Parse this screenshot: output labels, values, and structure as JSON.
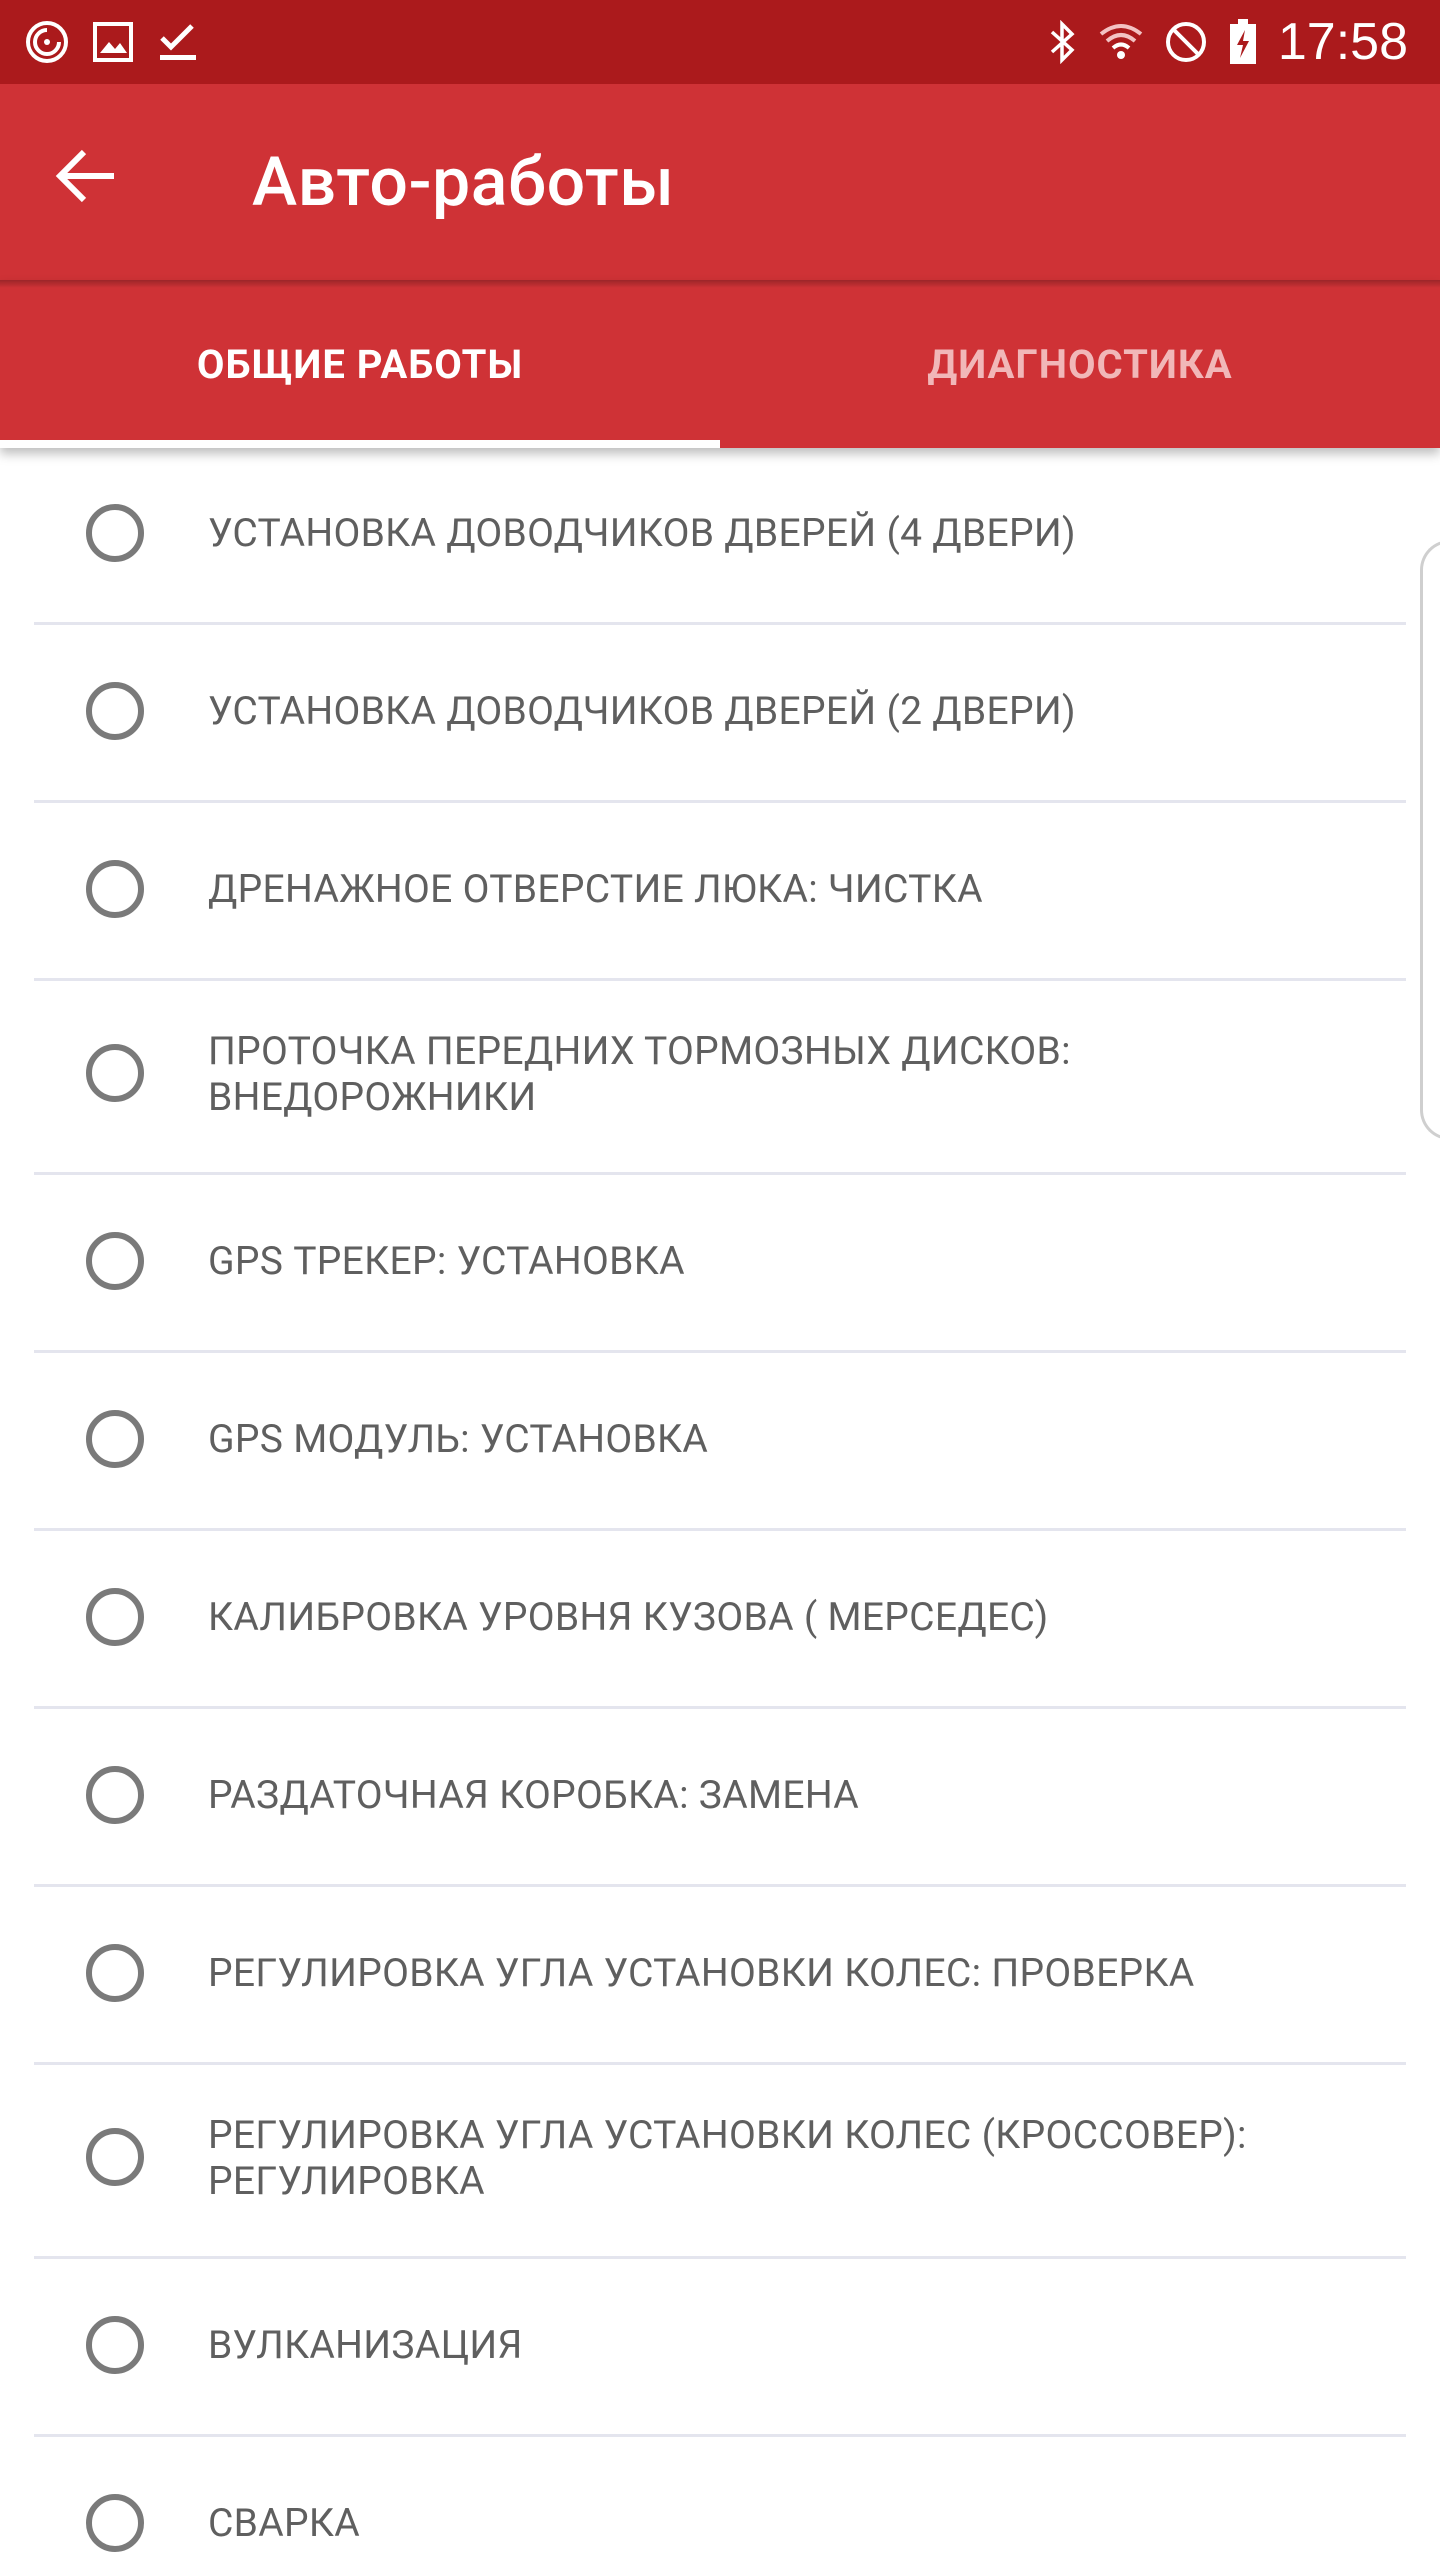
{
  "status_bar": {
    "time": "17:58",
    "left_icons": [
      "sync-icon",
      "image-icon",
      "check-icon"
    ],
    "right_icons": [
      "bluetooth-icon",
      "wifi-icon",
      "do-not-disturb-icon",
      "battery-charging-icon"
    ]
  },
  "app_bar": {
    "title": "Авто-работы"
  },
  "tabs": [
    {
      "label": "ОБЩИЕ РАБОТЫ",
      "active": true
    },
    {
      "label": "ДИАГНОСТИКА",
      "active": false
    }
  ],
  "items": [
    {
      "label": "УСТАНОВКА ДОВОДЧИКОВ ДВЕРЕЙ (4 ДВЕРИ)"
    },
    {
      "label": "УСТАНОВКА ДОВОДЧИКОВ ДВЕРЕЙ (2 ДВЕРИ)"
    },
    {
      "label": "ДРЕНАЖНОЕ ОТВЕРСТИЕ ЛЮКА: ЧИСТКА"
    },
    {
      "label": "ПРОТОЧКА ПЕРЕДНИХ ТОРМОЗНЫХ ДИСКОВ: ВНЕДОРОЖНИКИ"
    },
    {
      "label": "GPS ТРЕКЕР: УСТАНОВКА"
    },
    {
      "label": "GPS МОДУЛЬ: УСТАНОВКА"
    },
    {
      "label": "КАЛИБРОВКА УРОВНЯ КУЗОВА ( МЕРСЕДЕС)"
    },
    {
      "label": "РАЗДАТОЧНАЯ КОРОБКА: ЗАМЕНА"
    },
    {
      "label": "РЕГУЛИРОВКА УГЛА УСТАНОВКИ КОЛЕС: ПРОВЕРКА"
    },
    {
      "label": "РЕГУЛИРОВКА УГЛА УСТАНОВКИ КОЛЕС (КРОССОВЕР): РЕГУЛИРОВКА"
    },
    {
      "label": "ВУЛКАНИЗАЦИЯ"
    },
    {
      "label": "СВАРКА"
    }
  ],
  "colors": {
    "status_bar": "#ab1a1c",
    "app_bar": "#cf3236",
    "tab_inactive_text": "#f1b7b8",
    "item_text": "#5f5f5f",
    "radio": "#7a7a7a",
    "divider": "#e4e5ee"
  }
}
